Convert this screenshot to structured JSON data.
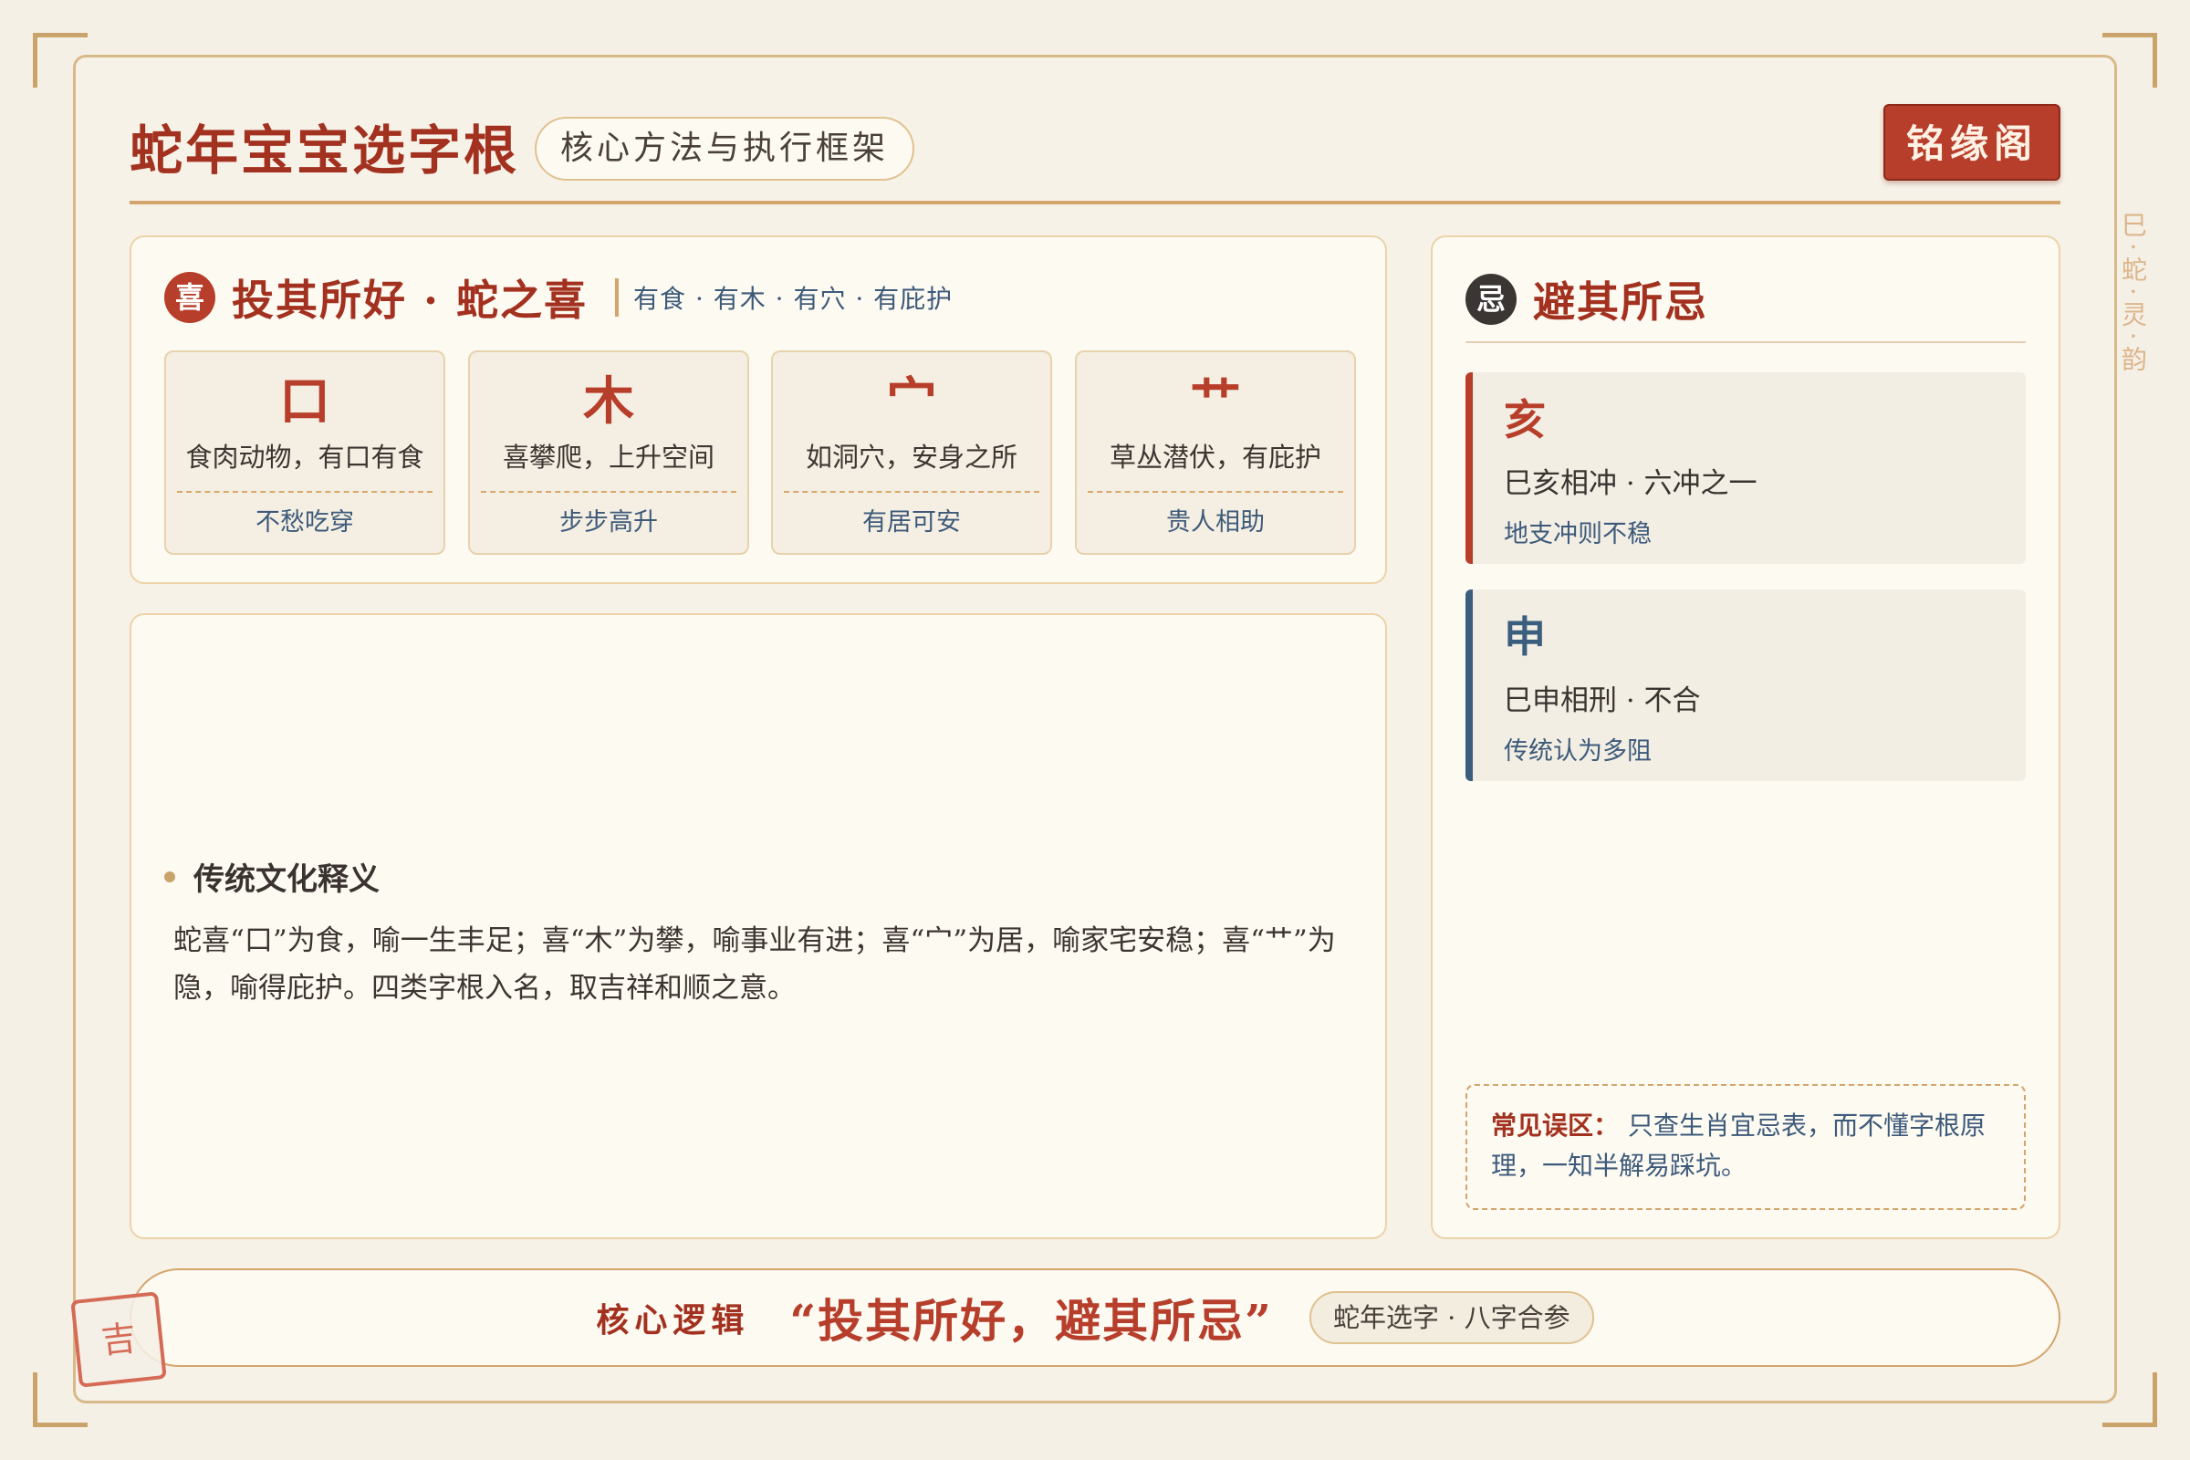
{
  "header": {
    "title": "蛇年宝宝选字根",
    "subtitle": "核心方法与执行框架",
    "brand": "铭缘阁"
  },
  "side_text": "巳·蛇·灵·韵",
  "like": {
    "badge": "喜",
    "title": "投其所好 · 蛇之喜",
    "tags": "有食 · 有木 · 有穴 · 有庇护",
    "cards": [
      {
        "glyph": "口",
        "desc": "食肉动物，有口有食",
        "note": "不愁吃穿"
      },
      {
        "glyph": "木",
        "desc": "喜攀爬，上升空间",
        "note": "步步高升"
      },
      {
        "glyph": "宀",
        "desc": "如洞穴，安身之所",
        "note": "有居可安"
      },
      {
        "glyph": "艹",
        "desc": "草丛潜伏，有庇护",
        "note": "贵人相助"
      }
    ]
  },
  "meaning": {
    "title": "传统文化释义",
    "text": "蛇喜“口”为食，喻一生丰足；喜“木”为攀，喻事业有进；喜“宀”为居，喻家宅安稳；喜“艹”为隐，喻得庇护。四类字根入名，取吉祥和顺之意。"
  },
  "avoid": {
    "badge": "忌",
    "title": "避其所忌",
    "items": [
      {
        "glyph": "亥",
        "relation": "巳亥相冲 · 六冲之一",
        "sub": "地支冲则不稳"
      },
      {
        "glyph": "申",
        "relation": "巳申相刑 · 不合",
        "sub": "传统认为多阻"
      }
    ],
    "mistake_label": "常见误区：",
    "mistake_text": "只查生肖宜忌表，而不懂字根原理，一知半解易踩坑。"
  },
  "bottom": {
    "label": "核心逻辑",
    "quote": "“投其所好，避其所忌”",
    "pill": "蛇年选字 · 八字合参"
  },
  "stamp": "吉",
  "colors": {
    "primary_red": "#b73e2b",
    "title_red": "#a3311f",
    "gold": "#d3a56c",
    "navy": "#3b5d7e",
    "background": "#f5f0e6"
  }
}
